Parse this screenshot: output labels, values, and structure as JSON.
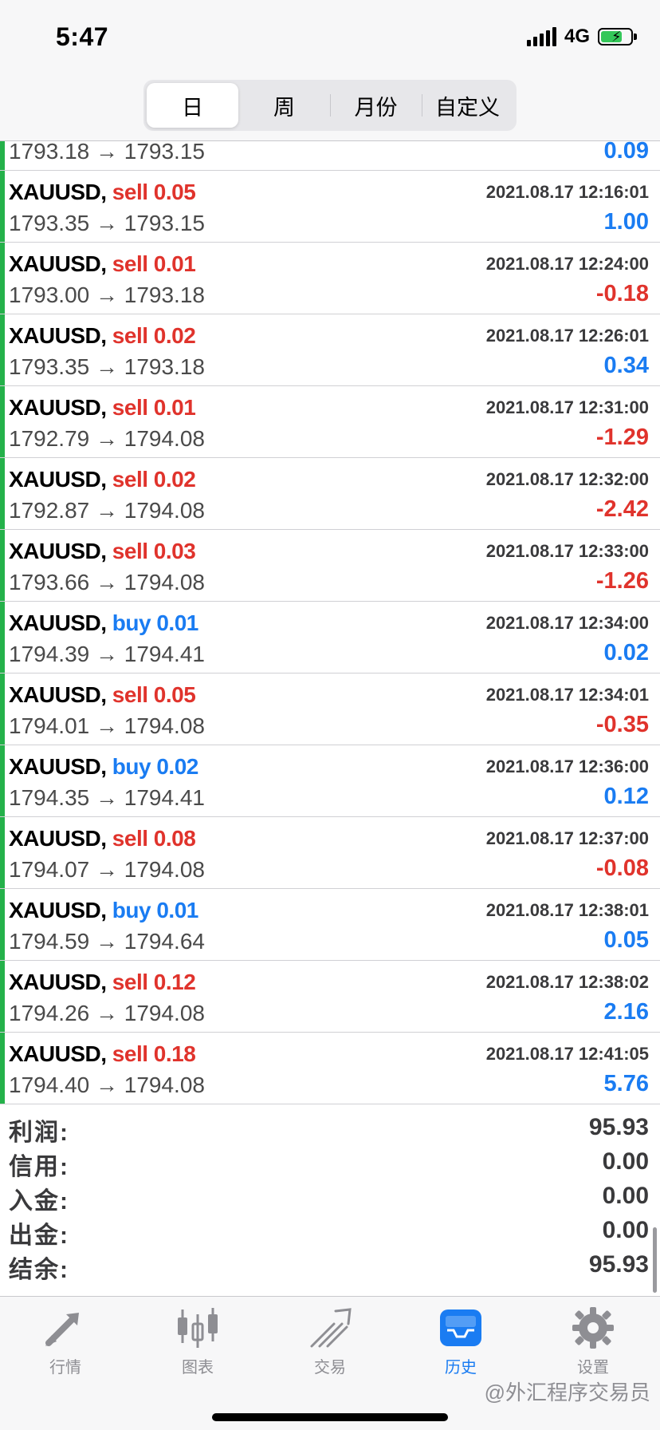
{
  "status": {
    "time": "5:47",
    "network": "4G"
  },
  "segments": [
    "日",
    "周",
    "月份",
    "自定义"
  ],
  "partial_row": {
    "prices": "1793.18 → 1793.15",
    "profit": "0.09",
    "profit_sign": "pos"
  },
  "rows": [
    {
      "symbol": "XAUUSD,",
      "side": "sell 0.05",
      "type": "sell",
      "time": "2021.08.17 12:16:01",
      "prices": "1793.35 → 1793.15",
      "profit": "1.00",
      "sign": "pos"
    },
    {
      "symbol": "XAUUSD,",
      "side": "sell 0.01",
      "type": "sell",
      "time": "2021.08.17 12:24:00",
      "prices": "1793.00 → 1793.18",
      "profit": "-0.18",
      "sign": "neg"
    },
    {
      "symbol": "XAUUSD,",
      "side": "sell 0.02",
      "type": "sell",
      "time": "2021.08.17 12:26:01",
      "prices": "1793.35 → 1793.18",
      "profit": "0.34",
      "sign": "pos"
    },
    {
      "symbol": "XAUUSD,",
      "side": "sell 0.01",
      "type": "sell",
      "time": "2021.08.17 12:31:00",
      "prices": "1792.79 → 1794.08",
      "profit": "-1.29",
      "sign": "neg"
    },
    {
      "symbol": "XAUUSD,",
      "side": "sell 0.02",
      "type": "sell",
      "time": "2021.08.17 12:32:00",
      "prices": "1792.87 → 1794.08",
      "profit": "-2.42",
      "sign": "neg"
    },
    {
      "symbol": "XAUUSD,",
      "side": "sell 0.03",
      "type": "sell",
      "time": "2021.08.17 12:33:00",
      "prices": "1793.66 → 1794.08",
      "profit": "-1.26",
      "sign": "neg"
    },
    {
      "symbol": "XAUUSD,",
      "side": "buy 0.01",
      "type": "buy",
      "time": "2021.08.17 12:34:00",
      "prices": "1794.39 → 1794.41",
      "profit": "0.02",
      "sign": "pos"
    },
    {
      "symbol": "XAUUSD,",
      "side": "sell 0.05",
      "type": "sell",
      "time": "2021.08.17 12:34:01",
      "prices": "1794.01 → 1794.08",
      "profit": "-0.35",
      "sign": "neg"
    },
    {
      "symbol": "XAUUSD,",
      "side": "buy 0.02",
      "type": "buy",
      "time": "2021.08.17 12:36:00",
      "prices": "1794.35 → 1794.41",
      "profit": "0.12",
      "sign": "pos"
    },
    {
      "symbol": "XAUUSD,",
      "side": "sell 0.08",
      "type": "sell",
      "time": "2021.08.17 12:37:00",
      "prices": "1794.07 → 1794.08",
      "profit": "-0.08",
      "sign": "neg"
    },
    {
      "symbol": "XAUUSD,",
      "side": "buy 0.01",
      "type": "buy",
      "time": "2021.08.17 12:38:01",
      "prices": "1794.59 → 1794.64",
      "profit": "0.05",
      "sign": "pos"
    },
    {
      "symbol": "XAUUSD,",
      "side": "sell 0.12",
      "type": "sell",
      "time": "2021.08.17 12:38:02",
      "prices": "1794.26 → 1794.08",
      "profit": "2.16",
      "sign": "pos"
    },
    {
      "symbol": "XAUUSD,",
      "side": "sell 0.18",
      "type": "sell",
      "time": "2021.08.17 12:41:05",
      "prices": "1794.40 → 1794.08",
      "profit": "5.76",
      "sign": "pos"
    }
  ],
  "summary": [
    {
      "label": "利润:",
      "value": "95.93"
    },
    {
      "label": "信用:",
      "value": "0.00"
    },
    {
      "label": "入金:",
      "value": "0.00"
    },
    {
      "label": "出金:",
      "value": "0.00"
    },
    {
      "label": "结余:",
      "value": "95.93"
    }
  ],
  "tabs": [
    {
      "label": "行情",
      "icon": "quotes-icon"
    },
    {
      "label": "图表",
      "icon": "chart-icon"
    },
    {
      "label": "交易",
      "icon": "trade-icon"
    },
    {
      "label": "历史",
      "icon": "history-icon",
      "active": true
    },
    {
      "label": "设置",
      "icon": "gear-icon"
    }
  ],
  "watermark": "@外汇程序交易员",
  "colors": {
    "sell": "#e0332c",
    "buy": "#1a7cf2",
    "accent": "#1a7cf2",
    "row_marker": "#24b14a"
  }
}
